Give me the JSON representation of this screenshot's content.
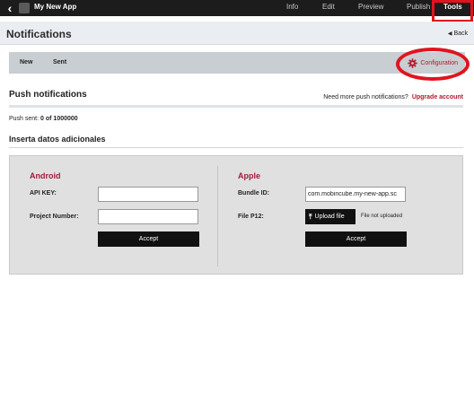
{
  "topbar": {
    "back_icon": "chevron-left-icon",
    "app_title": "My New App",
    "nav": [
      "Info",
      "Edit",
      "Preview",
      "Publish",
      "Tools"
    ],
    "active_nav": "Tools"
  },
  "subheader": {
    "title": "Notifications",
    "back_label": "Back"
  },
  "toolbar": {
    "tabs": [
      "New",
      "Sent"
    ],
    "configuration_label": "Configuration",
    "configuration_icon": "gear-icon"
  },
  "push": {
    "title": "Push notifications",
    "need_more": "Need more push notifications?",
    "upgrade_label": "Upgrade account",
    "sent_label": "Push sent:",
    "sent_value": "0 of 1000000"
  },
  "extra_title": "Inserta datos adicionales",
  "android": {
    "title": "Android",
    "api_key_label": "API KEY:",
    "api_key_value": "",
    "project_number_label": "Project Number:",
    "project_number_value": "",
    "accept_label": "Accept"
  },
  "apple": {
    "title": "Apple",
    "bundle_id_label": "Bundle ID:",
    "bundle_id_value": "com.mobincube.my-new-app.sc",
    "file_label": "File P12:",
    "upload_label": "Upload file",
    "upload_icon": "upload-icon",
    "file_status": "File not uploaded",
    "accept_label": "Accept"
  },
  "colors": {
    "accent": "#b01a2a",
    "section_title": "#a01c3c",
    "topbar_bg": "#1c1c1c",
    "highlight": "#e0141e"
  }
}
